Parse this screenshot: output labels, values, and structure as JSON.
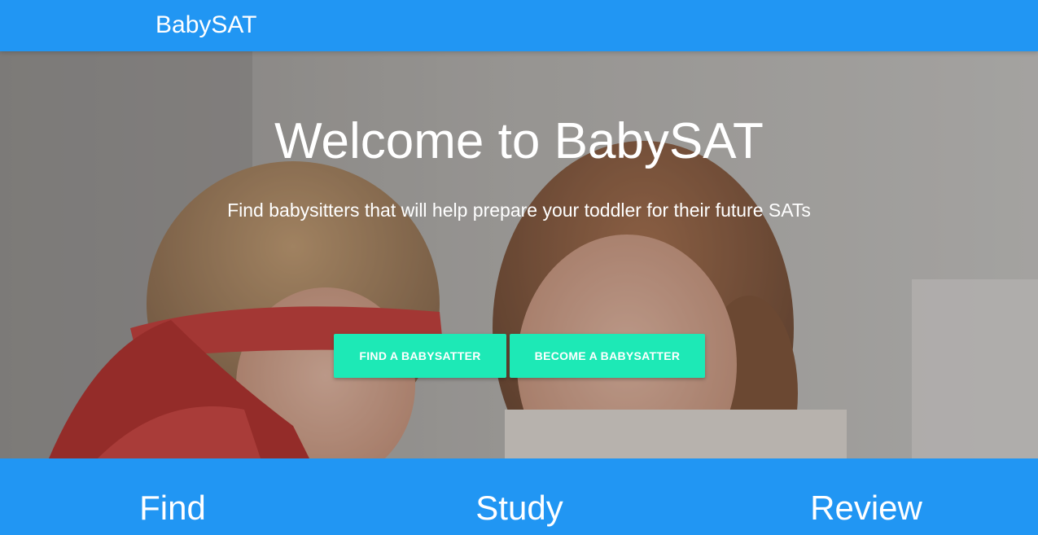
{
  "navbar": {
    "brand": "BabySAT"
  },
  "hero": {
    "title": "Welcome to BabySAT",
    "subtitle": "Find babysitters that will help prepare your toddler for their future SATs",
    "background_image": "photo-child-in-red-mask-with-smiling-woman",
    "buttons": [
      {
        "label": "FIND A BABYSATTER"
      },
      {
        "label": "BECOME A BABYSATTER"
      }
    ]
  },
  "features": {
    "items": [
      {
        "label": "Find"
      },
      {
        "label": "Study"
      },
      {
        "label": "Review"
      }
    ]
  },
  "colors": {
    "primary": "#2196f3",
    "accent": "#1de9b6",
    "text_on_primary": "#ffffff"
  }
}
